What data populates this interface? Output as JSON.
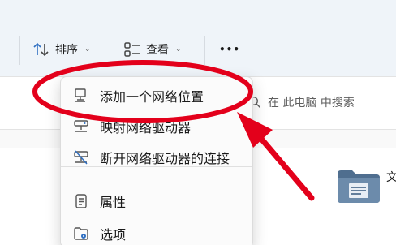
{
  "toolbar": {
    "sort_label": "排序",
    "view_label": "查看",
    "more_label": "•••"
  },
  "search": {
    "placeholder": "在 此电脑 中搜索"
  },
  "content": {
    "folder_label": "文"
  },
  "menu": {
    "items": [
      {
        "label": "添加一个网络位置",
        "icon": "network-location-icon"
      },
      {
        "label": "映射网络驱动器",
        "icon": "map-drive-icon"
      },
      {
        "label": "断开网络驱动器的连接",
        "icon": "disconnect-drive-icon"
      },
      {
        "label": "属性",
        "icon": "properties-icon"
      },
      {
        "label": "选项",
        "icon": "options-icon"
      }
    ]
  },
  "colors": {
    "annotation": "#e3001b",
    "accent": "#2f6fc2"
  }
}
